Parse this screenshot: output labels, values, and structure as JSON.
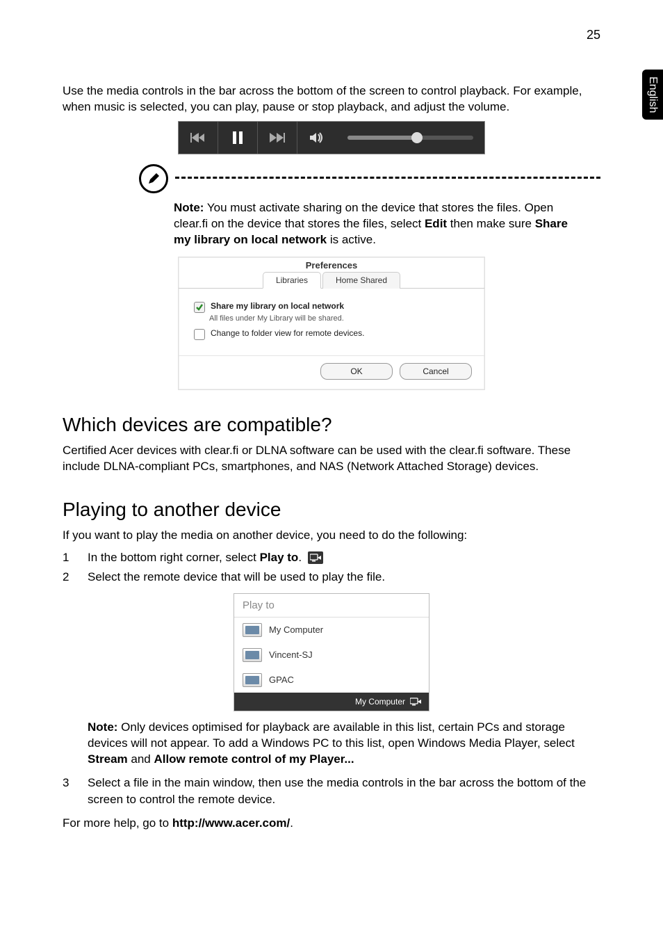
{
  "page_number": "25",
  "side_tab": "English",
  "intro_para": "Use the media controls in the bar across the bottom of the screen to control playback. For example, when music is selected, you can play, pause or stop playback, and adjust the volume.",
  "note1": {
    "label": "Note:",
    "text": " You must activate sharing on the device that stores the files. Open clear.fi on the device that stores the files, select ",
    "bold1": "Edit",
    "text2": " then make sure ",
    "bold2": "Share my library on local network",
    "text3": " is active."
  },
  "preferences": {
    "title": "Preferences",
    "tab_libraries": "Libraries",
    "tab_home_shared": "Home Shared",
    "share_label": "Share my library on local network",
    "share_sub": "All files under My Library will be shared.",
    "change_label": "Change to folder view for remote devices.",
    "ok": "OK",
    "cancel": "Cancel"
  },
  "h_compatible": "Which devices are compatible?",
  "compatible_para": "Certified Acer devices with clear.fi or DLNA software can be used with the clear.fi software. These include DLNA-compliant PCs, smartphones, and NAS (Network Attached Storage) devices.",
  "h_playing": "Playing to another device",
  "playing_intro": "If you want to play the media on another device, you need to do the following:",
  "step1_pre": "In the bottom right corner, select ",
  "step1_bold": "Play to",
  "step1_post": ". ",
  "step2": "Select the remote device that will be used to play the file.",
  "playto": {
    "header": "Play to",
    "items": [
      "My Computer",
      "Vincent-SJ",
      "GPAC"
    ],
    "footer": "My Computer"
  },
  "note2": {
    "label": "Note:",
    "text": " Only devices optimised for playback are available in this list, certain PCs and storage devices will not appear. To add a Windows PC to this list, open Windows Media Player, select ",
    "bold1": "Stream",
    "mid": " and ",
    "bold2": "Allow remote control of my Player..."
  },
  "step3": "Select a file in the main window, then use the media controls in the bar across the bottom of the screen to control the remote device.",
  "more_help_pre": "For more help, go to ",
  "more_help_url": "http://www.acer.com/",
  "more_help_post": "."
}
